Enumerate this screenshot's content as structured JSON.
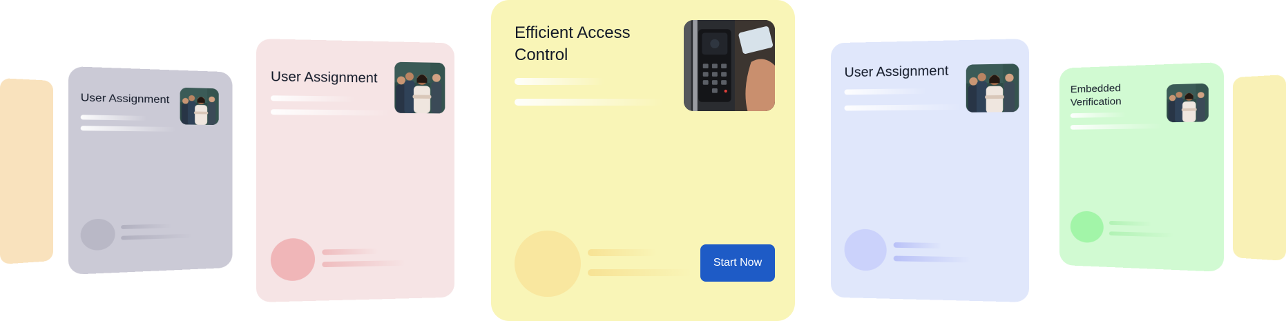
{
  "carousel": {
    "cards": [
      {
        "id": "edge-left",
        "color": "#f9e2bd"
      },
      {
        "id": "gray",
        "title": "User Assignment",
        "color": "#cbcad6",
        "image": "team-portrait-photo"
      },
      {
        "id": "pink",
        "title": "User Assignment",
        "color": "#f6e4e5",
        "image": "team-portrait-photo"
      },
      {
        "id": "center",
        "title": "Efficient Access Control",
        "color": "#f9f5b7",
        "image": "keycard-reader-photo",
        "button_label": "Start Now",
        "button_color": "#1e5bc6"
      },
      {
        "id": "blue",
        "title": "User Assignment",
        "color": "#e0e7fb",
        "image": "team-portrait-photo"
      },
      {
        "id": "green",
        "title": "Embedded Verification",
        "color": "#d1fad2",
        "image": "team-portrait-photo"
      },
      {
        "id": "edge-right",
        "color": "#f9f1b6"
      }
    ]
  }
}
